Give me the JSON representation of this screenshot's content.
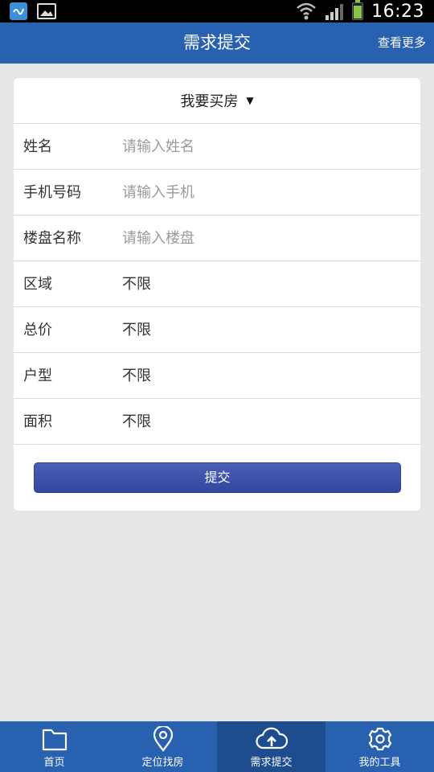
{
  "status_bar": {
    "time": "16:23",
    "icons": [
      "app-notification-icon",
      "image-notification-icon",
      "wifi-icon",
      "signal-icon",
      "battery-icon"
    ]
  },
  "header": {
    "title": "需求提交",
    "more_link": "查看更多"
  },
  "form": {
    "type_selector": "我要买房",
    "rows": [
      {
        "label": "姓名",
        "value": "请输入姓名",
        "placeholder": true
      },
      {
        "label": "手机号码",
        "value": "请输入手机",
        "placeholder": true
      },
      {
        "label": "楼盘名称",
        "value": "请输入楼盘",
        "placeholder": true
      },
      {
        "label": "区域",
        "value": "不限",
        "placeholder": false
      },
      {
        "label": "总价",
        "value": "不限",
        "placeholder": false
      },
      {
        "label": "户型",
        "value": "不限",
        "placeholder": false
      },
      {
        "label": "面积",
        "value": "不限",
        "placeholder": false
      }
    ],
    "submit_label": "提交"
  },
  "tabbar": {
    "tabs": [
      {
        "label": "首页",
        "icon": "folder-icon",
        "active": false
      },
      {
        "label": "定位找房",
        "icon": "location-pin-icon",
        "active": false
      },
      {
        "label": "需求提交",
        "icon": "cloud-upload-icon",
        "active": true
      },
      {
        "label": "我的工具",
        "icon": "gear-icon",
        "active": false
      }
    ]
  },
  "colors": {
    "header_bg": "#2861b0",
    "tab_active_bg": "#1d4c8f",
    "submit_button": "#3a4ea8",
    "page_bg": "#e6e6e6"
  }
}
